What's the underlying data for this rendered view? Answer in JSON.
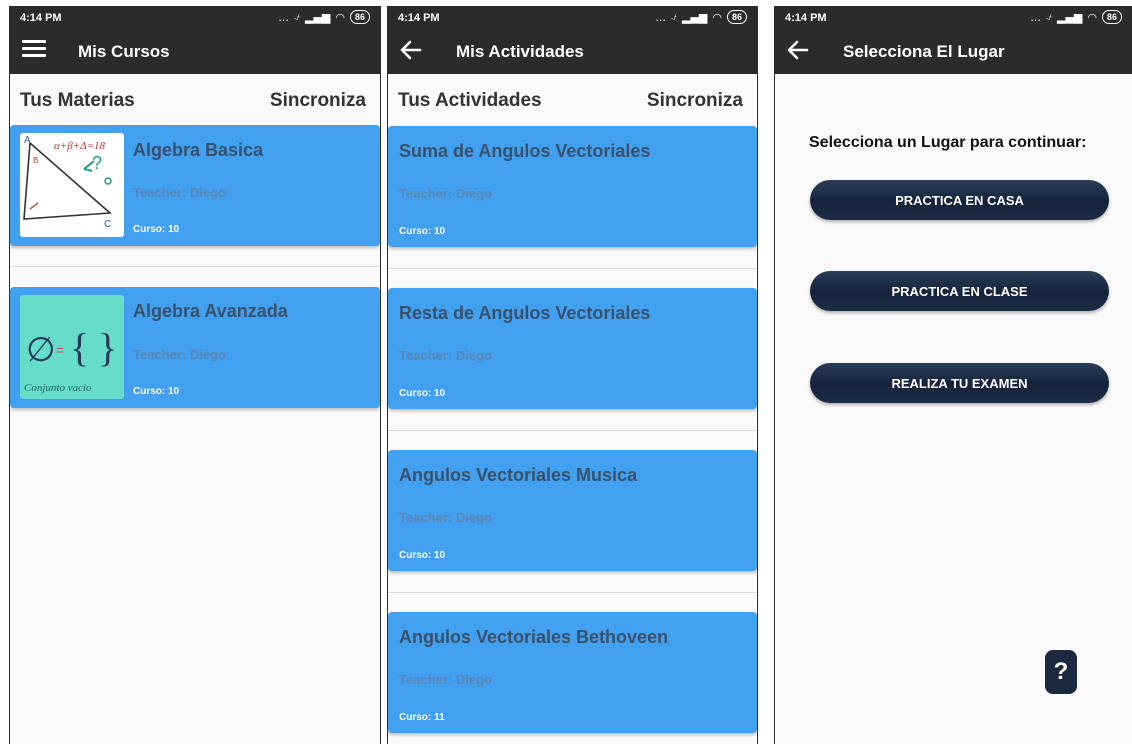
{
  "status_bar": {
    "time": "4:14 PM",
    "battery": "86",
    "dots": "..."
  },
  "screen1": {
    "title": "Mis Cursos",
    "section_title": "Tus Materias",
    "sync_label": "Sincroniza",
    "courses": [
      {
        "name": "Algebra Basica",
        "teacher": "Teacher: Diego",
        "course": "Curso: 10",
        "thumb_text": "α+β+Δ=18",
        "thumb_vertices": [
          "A",
          "B",
          "C"
        ]
      },
      {
        "name": "Algebra Avanzada",
        "teacher": "Teacher: Diego",
        "course": "Curso: 10",
        "thumb_text": "Conjunto vacio"
      }
    ]
  },
  "screen2": {
    "title": "Mis Actividades",
    "section_title": "Tus Actividades",
    "sync_label": "Sincroniza",
    "activities": [
      {
        "name": "Suma de Angulos Vectoriales",
        "teacher": "Teacher: Diego",
        "course": "Curso: 10"
      },
      {
        "name": "Resta de Angulos Vectoriales",
        "teacher": "Teacher: Diego",
        "course": "Curso: 10"
      },
      {
        "name": "Angulos Vectoriales Musica",
        "teacher": "Teacher: Diego",
        "course": "Curso: 10"
      },
      {
        "name": "Angulos Vectoriales Bethoveen",
        "teacher": "Teacher: Diego",
        "course": "Curso: 11"
      }
    ]
  },
  "screen3": {
    "title": "Selecciona El Lugar",
    "prompt": "Selecciona un Lugar para continuar:",
    "options": [
      {
        "label": "PRACTICA EN CASA"
      },
      {
        "label": "PRACTICA EN CLASE"
      },
      {
        "label": "REALIZA TU EXAMEN"
      }
    ],
    "help_label": "?"
  },
  "colors": {
    "app_bar": "#2b2b2b",
    "card": "#42a0f0",
    "button": "#15233a"
  },
  "icons": [
    "menu-icon",
    "back-arrow-icon",
    "wifi-icon",
    "signal-icon",
    "battery-icon",
    "help-icon"
  ]
}
